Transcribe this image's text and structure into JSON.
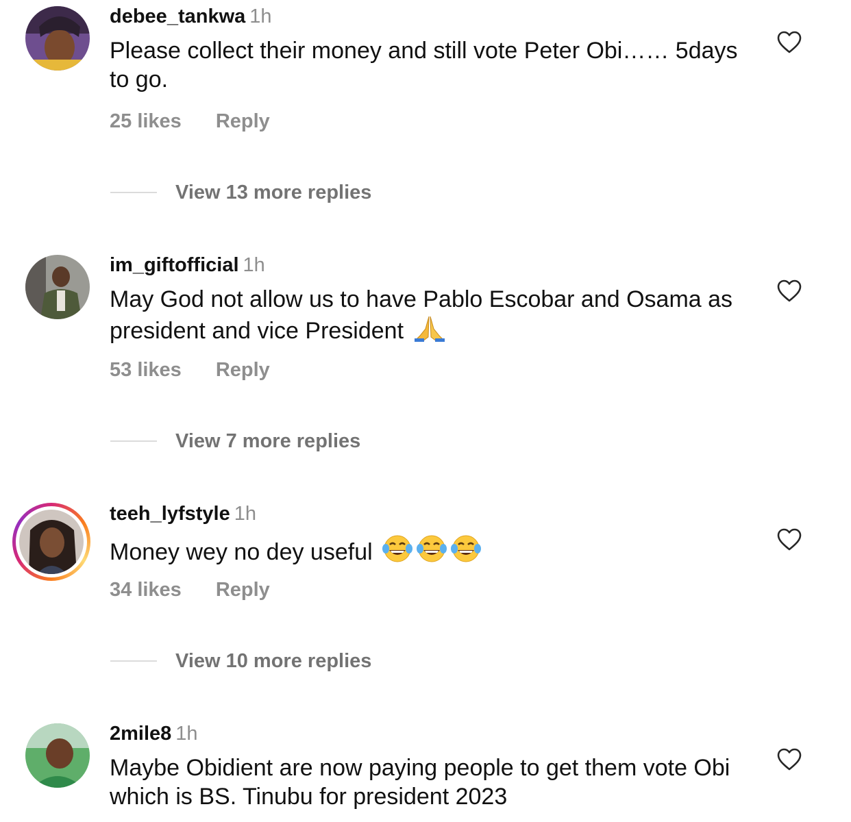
{
  "comments": [
    {
      "username": "debee_tankwa",
      "time": "1h",
      "text": "Please collect their money and still vote Peter Obi…… 5days to go.",
      "likes": "25 likes",
      "reply_label": "Reply",
      "view_replies": "View 13 more replies"
    },
    {
      "username": "im_giftofficial",
      "time": "1h",
      "text": "May God not allow us to have Pablo Escobar and Osama as president and vice President",
      "likes": "53 likes",
      "reply_label": "Reply",
      "view_replies": "View 7 more replies"
    },
    {
      "username": "teeh_lyfstyle",
      "time": "1h",
      "text": "Money wey no dey useful",
      "likes": "34 likes",
      "reply_label": "Reply",
      "view_replies": "View 10 more replies"
    },
    {
      "username": "2mile8",
      "time": "1h",
      "text": "Maybe Obidient are now paying people to get them vote Obi which is BS. Tinubu for president 2023"
    }
  ],
  "icons": {
    "like": "heart-outline-icon",
    "pray": "folded-hands-emoji",
    "laugh": "tears-of-joy-emoji"
  },
  "colors": {
    "secondary_text": "#8e8e8e",
    "story_ring": "#d62976"
  }
}
